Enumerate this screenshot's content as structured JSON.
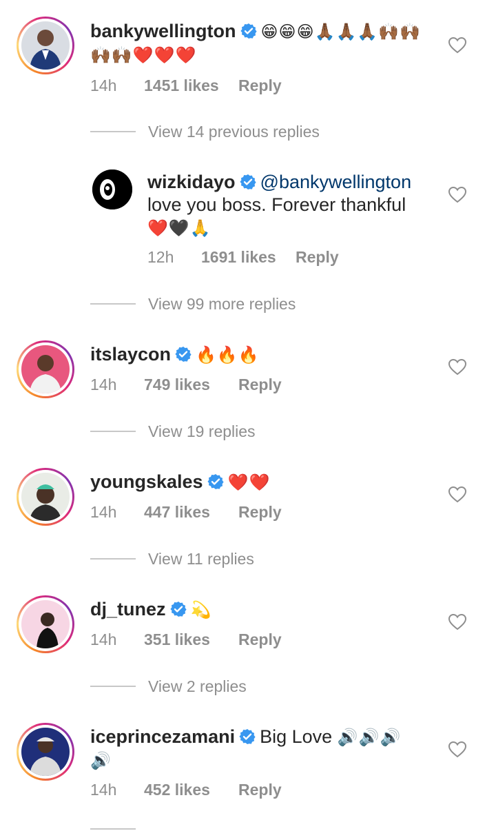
{
  "colors": {
    "verified_blue": "#3897f0",
    "mention": "#00376b",
    "muted": "#8e8e8e",
    "text": "#262626"
  },
  "comments": [
    {
      "username": "bankywellington",
      "verified": true,
      "text": "😁😁😁🙏🏾🙏🏾🙏🏾🙌🏾🙌🏾🙌🏾🙌🏾❤️❤️❤️",
      "time": "14h",
      "likes": "1451 likes",
      "reply_label": "Reply"
    },
    {
      "username": "wizkidayo",
      "verified": true,
      "mention": "@bankywellington",
      "text": "love you boss. Forever thankful",
      "emoji": "❤️🖤🙏",
      "time": "12h",
      "likes": "1691 likes",
      "reply_label": "Reply"
    },
    {
      "username": "itslaycon",
      "verified": true,
      "text": "🔥🔥🔥",
      "time": "14h",
      "likes": "749 likes",
      "reply_label": "Reply"
    },
    {
      "username": "youngskales",
      "verified": true,
      "text": "❤️❤️",
      "time": "14h",
      "likes": "447 likes",
      "reply_label": "Reply"
    },
    {
      "username": "dj_tunez",
      "verified": true,
      "text": "💫",
      "time": "14h",
      "likes": "351 likes",
      "reply_label": "Reply"
    },
    {
      "username": "iceprincezamani",
      "verified": true,
      "text": "Big Love",
      "emoji": "🔊🔊🔊🔊",
      "time": "14h",
      "likes": "452 likes",
      "reply_label": "Reply"
    }
  ],
  "view_links": {
    "banky_previous": "View 14 previous replies",
    "banky_more": "View 99 more replies",
    "laycon": "View 19 replies",
    "skales": "View 11 replies",
    "tunez": "View 2 replies"
  }
}
